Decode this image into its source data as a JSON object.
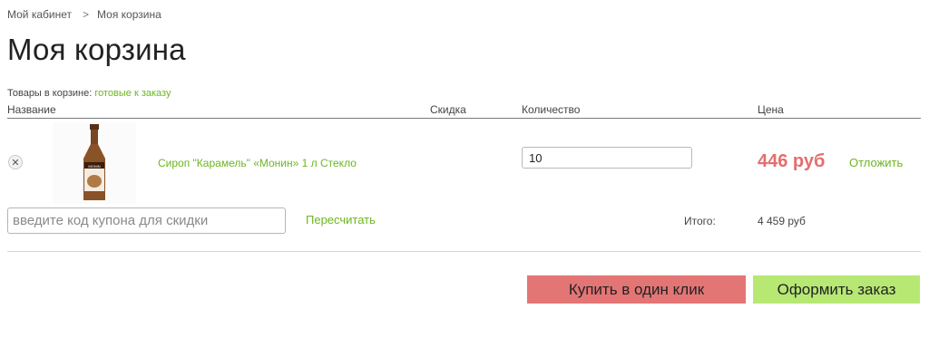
{
  "breadcrumb": {
    "home": "Мой кабинет",
    "separator": ">",
    "current": "Моя корзина"
  },
  "page_title": "Моя корзина",
  "cart_status": {
    "label": "Товары в корзине:",
    "link": "готовые к заказу"
  },
  "columns": {
    "name": "Название",
    "discount": "Скидка",
    "quantity": "Количество",
    "price": "Цена"
  },
  "item": {
    "name": "Сироп \"Карамель\" «Монин» 1 л Стекло",
    "quantity": "10",
    "price": "446 руб",
    "defer": "Отложить",
    "thumb_label": "MONIN"
  },
  "coupon": {
    "placeholder": "введите код купона для скидки",
    "recalc": "Пересчитать"
  },
  "total": {
    "label": "Итого:",
    "value": "4 459 руб"
  },
  "buttons": {
    "one_click": "Купить в один клик",
    "checkout": "Оформить заказ"
  },
  "colors": {
    "link": "#6cb61f",
    "price": "#e56d6d",
    "one_click_bg": "#e37575",
    "checkout_bg": "#b7e874"
  }
}
